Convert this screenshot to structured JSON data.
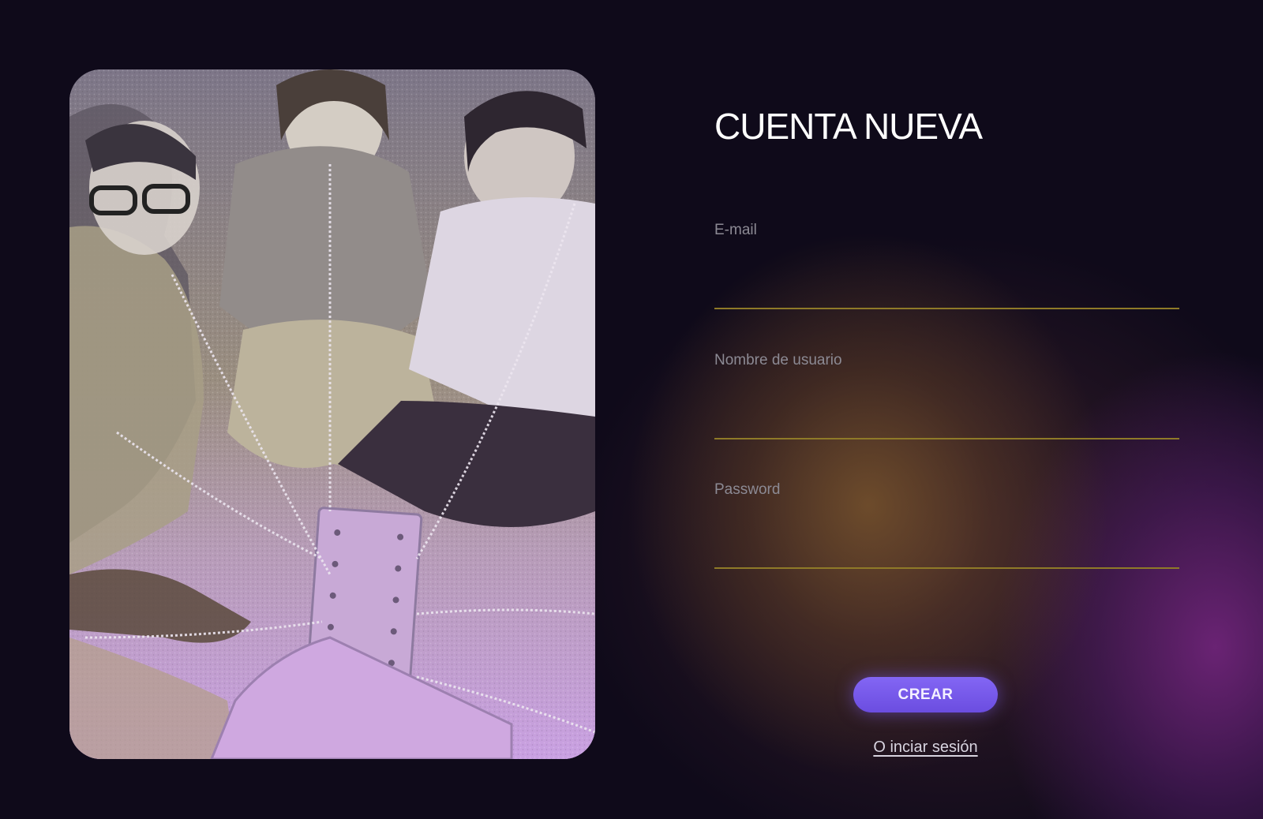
{
  "form": {
    "title": "CUENTA NUEVA",
    "fields": [
      {
        "label": "E-mail",
        "value": "",
        "placeholder": ""
      },
      {
        "label": "Nombre  de usuario",
        "value": "",
        "placeholder": ""
      },
      {
        "label": "Password",
        "value": "",
        "placeholder": ""
      }
    ],
    "submit_label": "CREAR",
    "login_link_label": "O inciar sesión"
  },
  "colors": {
    "background": "#0f0a1a",
    "accent": "#7b5cf0",
    "field_underline": "#8f7a28",
    "label_text": "#8c8a94",
    "title_text": "#ffffff"
  }
}
